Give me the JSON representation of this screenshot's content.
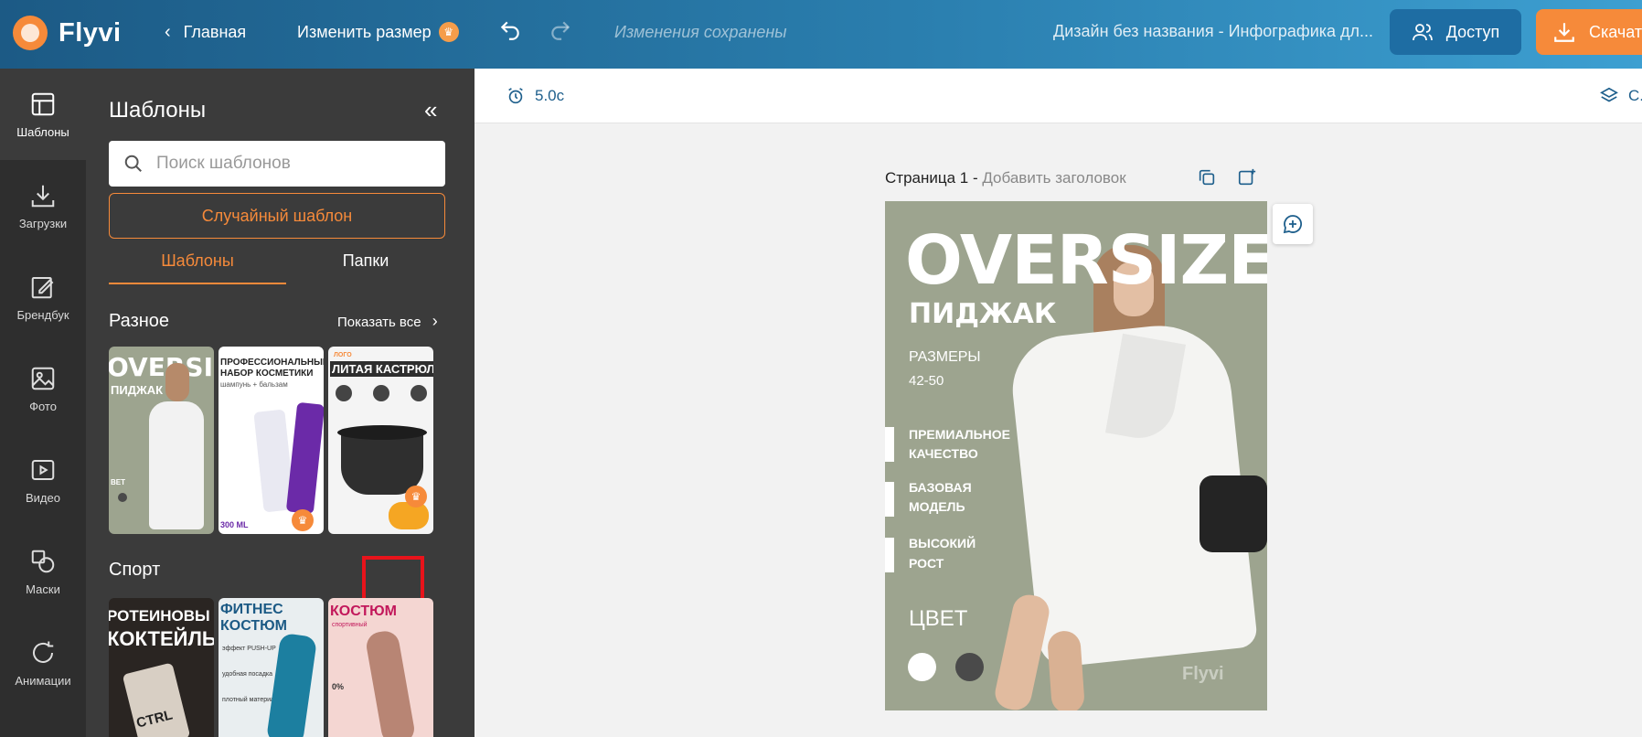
{
  "app": {
    "name": "Flyvi",
    "home_label": "Главная",
    "resize_label": "Изменить размер",
    "saved_status": "Изменения сохранены",
    "doc_title": "Дизайн без названия - Инфографика дл...",
    "access_label": "Доступ",
    "download_label": "Скачат",
    "accent_color": "#f68a3a"
  },
  "rail": {
    "items": [
      {
        "label": "Шаблоны",
        "icon": "layout-icon"
      },
      {
        "label": "Загрузки",
        "icon": "upload-icon"
      },
      {
        "label": "Брендбук",
        "icon": "brandbook-icon"
      },
      {
        "label": "Фото",
        "icon": "image-icon"
      },
      {
        "label": "Видео",
        "icon": "video-icon"
      },
      {
        "label": "Маски",
        "icon": "masks-icon"
      },
      {
        "label": "Анимации",
        "icon": "animation-icon"
      }
    ]
  },
  "panel": {
    "title": "Шаблоны",
    "search_placeholder": "Поиск шаблонов",
    "random_label": "Случайный шаблон",
    "tabs": [
      "Шаблоны",
      "Папки"
    ],
    "sections": [
      {
        "title": "Разное",
        "show_all": "Показать все"
      },
      {
        "title": "Спорт"
      }
    ],
    "thumbs_misc": [
      {
        "line1": "OVERSIZE",
        "line2": "ПИДЖАК",
        "corner": "ВЕТ"
      },
      {
        "line1": "ПРОФЕССИОНАЛЬНЫЙ",
        "line2": "НАБОР КОСМЕТИКИ",
        "line3": "шампунь + бальзам",
        "corner": "300 ML"
      },
      {
        "line1": "ЛОГО",
        "line2": "ЛИТАЯ КАСТРЮЛЯ"
      }
    ],
    "thumbs_sport": [
      {
        "line1": "РОТЕИНОВЫ",
        "line2": "КОКТЕЙЛЬ",
        "corner": "CTRL"
      },
      {
        "line1": "ФИТНЕС",
        "line2": "КОСТЮМ",
        "line3": "эффект PUSH-UP",
        "line4": "удобная посадка",
        "line5": "плотный материал"
      },
      {
        "line1": "КОСТЮМ",
        "line2": "спортивный",
        "line3": "0%"
      }
    ]
  },
  "canvas": {
    "duration": "5.0с",
    "layers_label": "С...",
    "page_label": "Страница 1 - ",
    "page_sub": "Добавить заголовок"
  },
  "design": {
    "title": "OVERSIZE",
    "subtitle": "ПИДЖАК",
    "sizes_label": "РАЗМЕРЫ",
    "sizes_value": "42-50",
    "features": [
      {
        "line1": "ПРЕМИАЛЬНОЕ",
        "line2": "КАЧЕСТВО"
      },
      {
        "line1": "БАЗОВАЯ",
        "line2": "МОДЕЛЬ"
      },
      {
        "line1": "ВЫСОКИЙ",
        "line2": "РОСТ"
      }
    ],
    "color_label": "ЦВЕТ",
    "color_white": "#ffffff",
    "color_dark": "#4a4a4a",
    "watermark": "Flyvi",
    "background": "#9da48f"
  }
}
